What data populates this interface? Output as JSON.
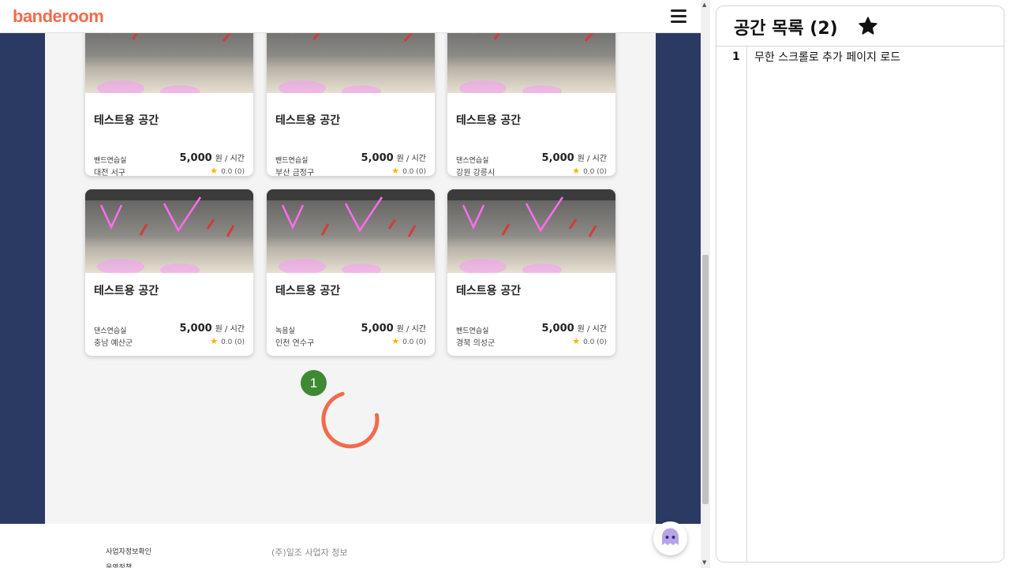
{
  "app": {
    "logo": "banderoom"
  },
  "cards": [
    {
      "title": "테스트용 공간",
      "category": "밴드연습실",
      "location": "대전 서구",
      "price": "5,000",
      "price_unit": "원 / 시간",
      "rating": "0.0 (0)"
    },
    {
      "title": "테스트용 공간",
      "category": "밴드연습실",
      "location": "부산 금정구",
      "price": "5,000",
      "price_unit": "원 / 시간",
      "rating": "0.0 (0)"
    },
    {
      "title": "테스트용 공간",
      "category": "댄스연습실",
      "location": "강원 강릉시",
      "price": "5,000",
      "price_unit": "원 / 시간",
      "rating": "0.0 (0)"
    },
    {
      "title": "테스트용 공간",
      "category": "댄스연습실",
      "location": "충남 예산군",
      "price": "5,000",
      "price_unit": "원 / 시간",
      "rating": "0.0 (0)"
    },
    {
      "title": "테스트용 공간",
      "category": "녹음실",
      "location": "인천 연수구",
      "price": "5,000",
      "price_unit": "원 / 시간",
      "rating": "0.0 (0)"
    },
    {
      "title": "테스트용 공간",
      "category": "밴드연습실",
      "location": "경북 의성군",
      "price": "5,000",
      "price_unit": "원 / 시간",
      "rating": "0.0 (0)"
    }
  ],
  "marker": {
    "label": "1",
    "color": "#3e8a33"
  },
  "spinner": {
    "color": "#f26b4c"
  },
  "footer": {
    "link1": "사업자정보확인",
    "link2": "운영정책",
    "company": "(주)일조 사업자 정보"
  },
  "panel": {
    "title": "공간 목록 (2)",
    "rows": [
      {
        "num": "1",
        "text": "무한 스크롤로 추가 페이지 로드"
      }
    ]
  },
  "colors": {
    "brand": "#f26b4c",
    "background": "#2a3a63",
    "star": "#f5b400"
  }
}
